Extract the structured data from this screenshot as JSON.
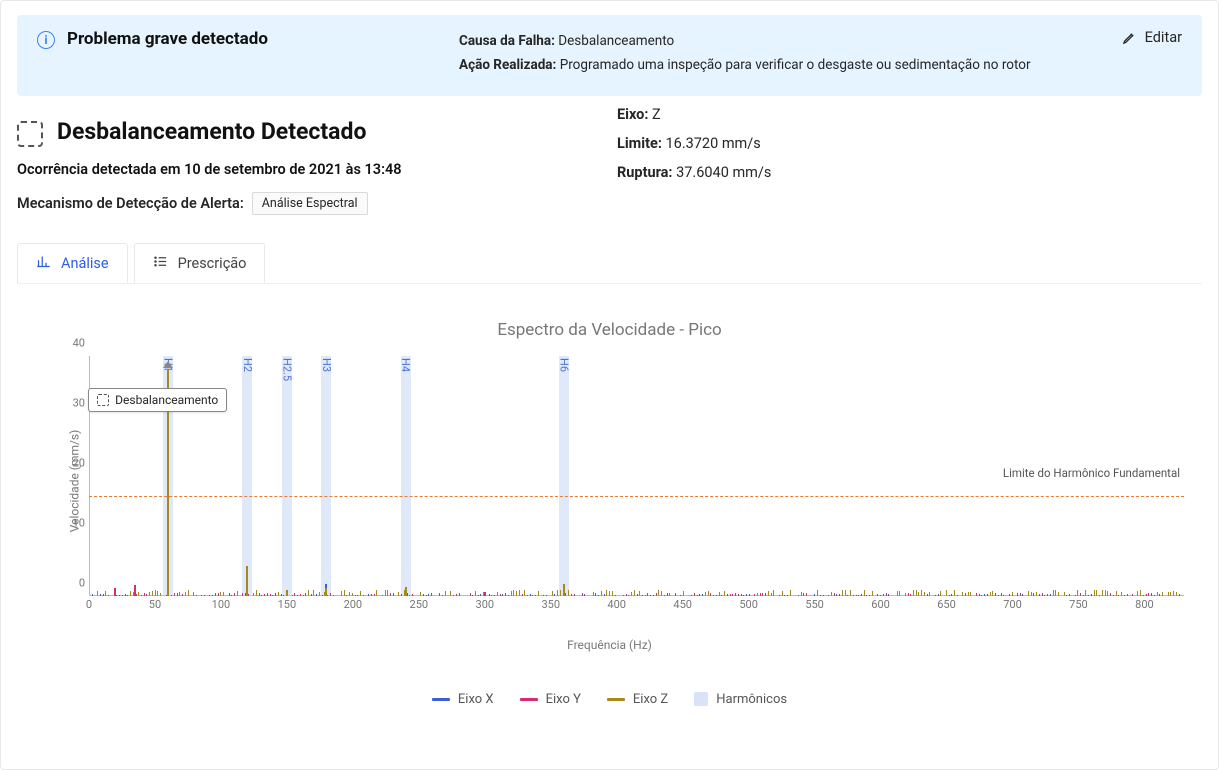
{
  "alert": {
    "title": "Problema grave detectado",
    "cause_label": "Causa da Falha:",
    "cause_value": "Desbalanceamento",
    "action_label": "Ação Realizada:",
    "action_value": "Programado uma inspeção para verificar o desgaste ou sedimentação no rotor",
    "edit": "Editar"
  },
  "headline": {
    "title": "Desbalanceamento Detectado",
    "occurrence": "Ocorrência detectada em 10 de setembro de 2021 às 13:48",
    "mechanism_label": "Mecanismo de Detecção de Alerta:",
    "mechanism_tag": "Análise Espectral"
  },
  "metrics": {
    "axis_label": "Eixo:",
    "axis_value": "Z",
    "limit_label": "Limite:",
    "limit_value": "16.3720 mm/s",
    "rupture_label": "Ruptura:",
    "rupture_value": "37.6040 mm/s"
  },
  "tabs": {
    "analysis": "Análise",
    "prescription": "Prescrição"
  },
  "tooltip": "Desbalanceamento",
  "chart_data": {
    "type": "line",
    "title": "Espectro da Velocidade - Pico",
    "xlabel": "Frequência (Hz)",
    "ylabel": "Velocidade (mm/s)",
    "xlim": [
      0,
      830
    ],
    "ylim": [
      0,
      40
    ],
    "xticks": [
      0,
      50,
      100,
      150,
      200,
      250,
      300,
      350,
      400,
      450,
      500,
      550,
      600,
      650,
      700,
      750,
      800
    ],
    "yticks": [
      0,
      10,
      20,
      30,
      40
    ],
    "limit_line": {
      "value": 16.372,
      "label": "Limite do Harmônico Fundamental"
    },
    "harmonic_bands": [
      {
        "label": "H1",
        "freq": 60
      },
      {
        "label": "H2",
        "freq": 120
      },
      {
        "label": "H2.5",
        "freq": 150
      },
      {
        "label": "H3",
        "freq": 180
      },
      {
        "label": "H4",
        "freq": 240
      },
      {
        "label": "H6",
        "freq": 360
      }
    ],
    "series": [
      {
        "name": "Eixo X",
        "color": "#3c5fd8",
        "peaks": [
          {
            "x": 60,
            "y": 1.5
          },
          {
            "x": 180,
            "y": 2.0
          },
          {
            "x": 240,
            "y": 0.8
          }
        ]
      },
      {
        "name": "Eixo Y",
        "color": "#d42d74",
        "peaks": [
          {
            "x": 20,
            "y": 1.2
          },
          {
            "x": 35,
            "y": 1.8
          },
          {
            "x": 60,
            "y": 1.0
          },
          {
            "x": 300,
            "y": 0.6
          }
        ]
      },
      {
        "name": "Eixo Z",
        "color": "#a58a1a",
        "peaks": [
          {
            "x": 60,
            "y": 37.6
          },
          {
            "x": 120,
            "y": 5.0
          },
          {
            "x": 150,
            "y": 1.0
          },
          {
            "x": 180,
            "y": 1.2
          },
          {
            "x": 240,
            "y": 1.5
          },
          {
            "x": 360,
            "y": 2.0
          }
        ]
      }
    ],
    "legend": [
      "Eixo X",
      "Eixo Y",
      "Eixo Z",
      "Harmônicos"
    ]
  }
}
